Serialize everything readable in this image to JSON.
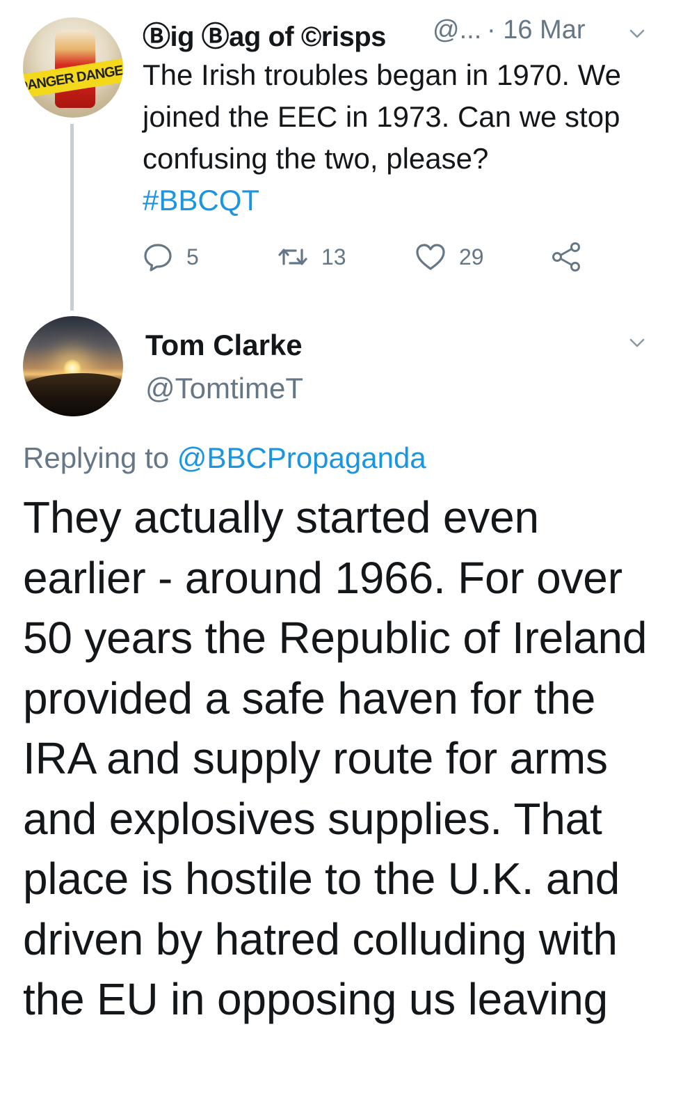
{
  "tweet1": {
    "author_name": "Ⓑig Ⓑag of ©risps",
    "handle": "@...",
    "date": "· 16 Mar",
    "avatar_text": "DANGER DANGER",
    "text": "The Irish troubles began in 1970. We joined the EEC in 1973. Can we stop confusing the two, please?",
    "hashtag": "#BBCQT",
    "replies": "5",
    "retweets": "13",
    "likes": "29",
    "icons": {
      "reply": "reply-icon",
      "retweet": "retweet-icon",
      "like": "heart-icon",
      "share": "share-icon",
      "menu": "chevron-down-icon"
    }
  },
  "tweet2": {
    "author_name": "Tom Clarke",
    "handle": "@TomtimeT",
    "replying_prefix": "Replying to",
    "replying_to": "@BBCPropaganda",
    "text": "They actually started even earlier - around 1966. For over 50 years the Republic of Ireland provided a safe haven for the IRA and supply route for arms and explosives supplies. That place is hostile to the U.K. and driven by hatred colluding with the EU in opposing us leaving"
  },
  "colors": {
    "link": "#1b95e0",
    "secondary_text": "#657786",
    "primary_text": "#14171a",
    "thread_line": "#c7ced3"
  }
}
